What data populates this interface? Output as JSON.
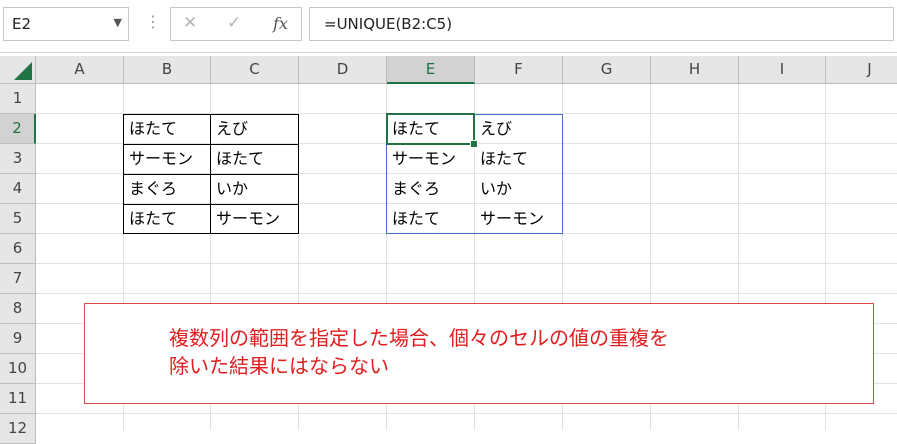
{
  "formula_bar": {
    "name_box": "E2",
    "cancel_icon": "✕",
    "enter_icon": "✓",
    "fx_icon": "fx",
    "formula": "=UNIQUE(B2:C5)"
  },
  "columns": [
    "A",
    "B",
    "C",
    "D",
    "E",
    "F",
    "G",
    "H",
    "I",
    "J"
  ],
  "rows": [
    "1",
    "2",
    "3",
    "4",
    "5",
    "6",
    "7",
    "8",
    "9",
    "10",
    "11",
    "12"
  ],
  "selected": {
    "column": "E",
    "row": "2"
  },
  "source_range": {
    "cells": [
      [
        "ほたて",
        "えび"
      ],
      [
        "サーモン",
        "ほたて"
      ],
      [
        "まぐろ",
        "いか"
      ],
      [
        "ほたて",
        "サーモン"
      ]
    ]
  },
  "spill_range": {
    "cells": [
      [
        "ほたて",
        "えび"
      ],
      [
        "サーモン",
        "ほたて"
      ],
      [
        "まぐろ",
        "いか"
      ],
      [
        "ほたて",
        "サーモン"
      ]
    ]
  },
  "note": {
    "line1": "複数列の範囲を指定した場合、個々のセルの値の重複を",
    "line2": "除いた結果にはならない"
  },
  "colors": {
    "accent": "#217346",
    "spill": "#4472c4",
    "note": "#e01e1e"
  }
}
